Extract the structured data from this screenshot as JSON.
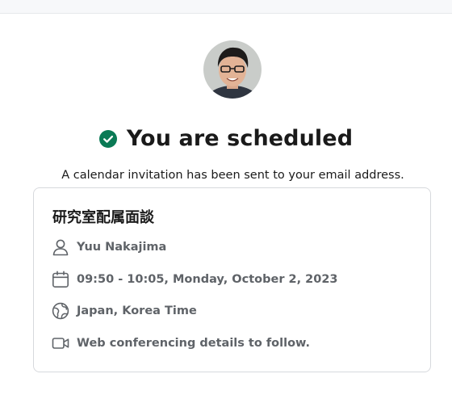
{
  "header": {
    "title": "You are scheduled",
    "subtitle": "A calendar invitation has been sent to your email address."
  },
  "event": {
    "title": "研究室配属面談",
    "host": "Yuu Nakajima",
    "datetime": "09:50 - 10:05, Monday, October 2, 2023",
    "timezone": "Japan, Korea Time",
    "location": "Web conferencing details to follow."
  },
  "colors": {
    "accent_green": "#0a7a55",
    "muted_text": "#5f6368"
  },
  "icons": {
    "status": "check-circle-icon",
    "host": "person-icon",
    "datetime": "calendar-icon",
    "timezone": "globe-icon",
    "location": "video-camera-icon"
  }
}
